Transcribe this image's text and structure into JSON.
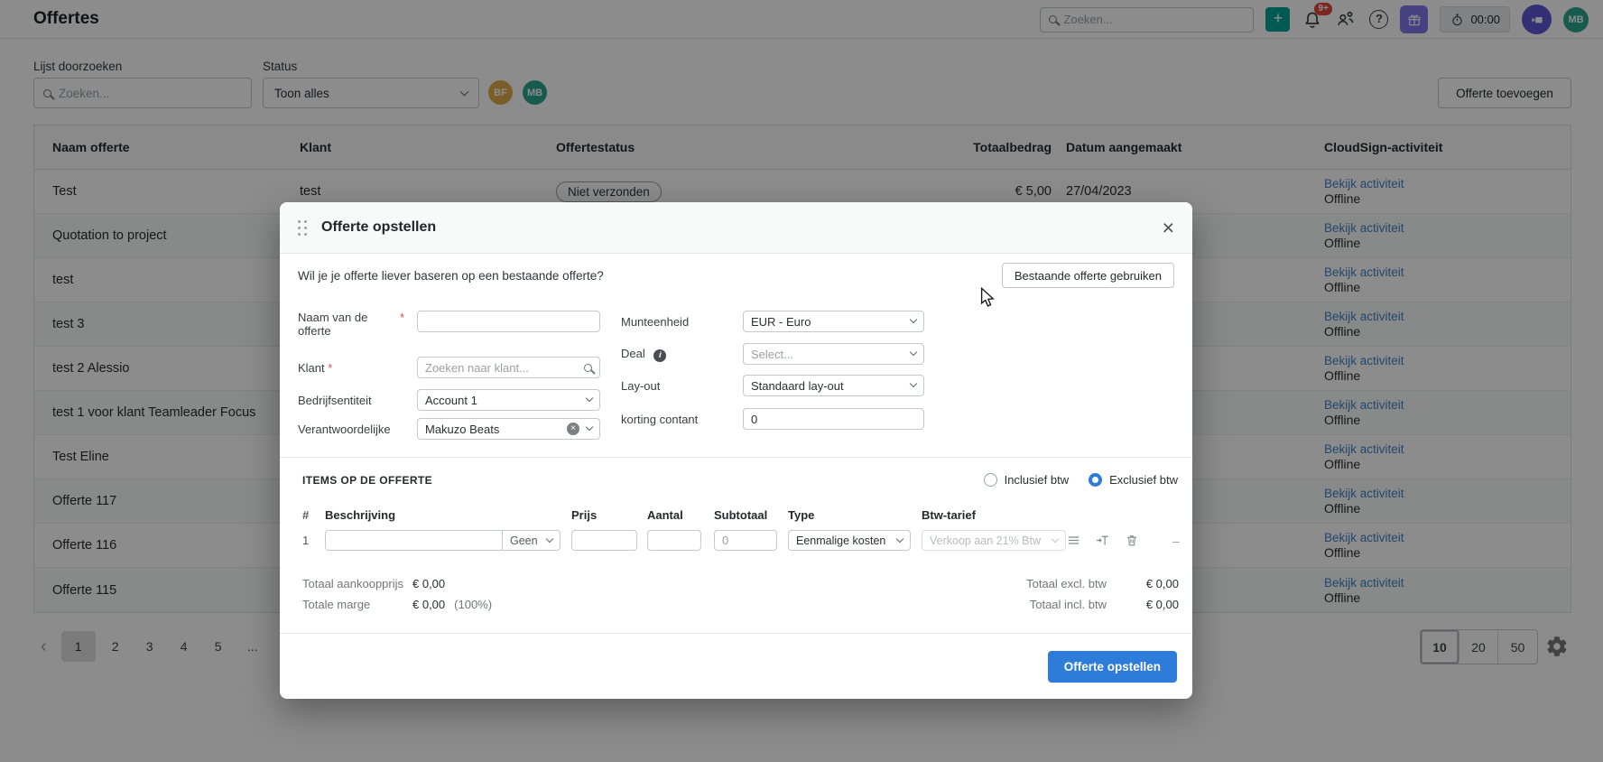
{
  "app": {
    "page_title": "Offertes",
    "topbar": {
      "search_placeholder": "Zoeken...",
      "notification_badge": "9+",
      "timer_value": "00:00",
      "user_initials": "MB"
    },
    "filters": {
      "search_label": "Lijst doorzoeken",
      "search_placeholder": "Zoeken...",
      "status_label": "Status",
      "status_value": "Toon alles",
      "avatar_1": "BF",
      "avatar_2": "MB",
      "add_button": "Offerte toevoegen"
    }
  },
  "table": {
    "columns": [
      "Naam offerte",
      "Klant",
      "Offertestatus",
      "Totaalbedrag",
      "Datum aangemaakt",
      "CloudSign-activiteit"
    ],
    "rows": [
      {
        "name": "Test",
        "klant": "test",
        "status": "Niet verzonden",
        "amount": "€ 5,00",
        "date": "27/04/2023",
        "activity": "Bekijk activiteit",
        "state": "Offline"
      },
      {
        "name": "Quotation to project",
        "klant": "",
        "status": "",
        "amount": "",
        "date": "",
        "activity": "Bekijk activiteit",
        "state": "Offline"
      },
      {
        "name": "test",
        "klant": "",
        "status": "",
        "amount": "",
        "date": "",
        "activity": "Bekijk activiteit",
        "state": "Offline"
      },
      {
        "name": "test 3",
        "klant": "",
        "status": "",
        "amount": "",
        "date": "",
        "activity": "Bekijk activiteit",
        "state": "Offline"
      },
      {
        "name": "test 2 Alessio",
        "klant": "",
        "status": "",
        "amount": "",
        "date": "",
        "activity": "Bekijk activiteit",
        "state": "Offline"
      },
      {
        "name": "test 1 voor klant Teamleader Focus",
        "klant": "",
        "status": "",
        "amount": "",
        "date": "",
        "activity": "Bekijk activiteit",
        "state": "Offline"
      },
      {
        "name": "Test Eline",
        "klant": "",
        "status": "",
        "amount": "",
        "date": "",
        "activity": "Bekijk activiteit",
        "state": "Offline"
      },
      {
        "name": "Offerte 117",
        "klant": "",
        "status": "",
        "amount": "",
        "date": "",
        "activity": "Bekijk activiteit",
        "state": "Offline"
      },
      {
        "name": "Offerte 116",
        "klant": "",
        "status": "",
        "amount": "",
        "date": "",
        "activity": "Bekijk activiteit",
        "state": "Offline"
      },
      {
        "name": "Offerte 115",
        "klant": "",
        "status": "",
        "amount": "",
        "date": "",
        "activity": "Bekijk activiteit",
        "state": "Offline"
      }
    ]
  },
  "pagination": {
    "prev": "‹",
    "pages": [
      "1",
      "2",
      "3",
      "4",
      "5",
      "..."
    ],
    "active_page": "1",
    "sizes": [
      "10",
      "20",
      "50"
    ],
    "active_size": "10"
  },
  "modal": {
    "title": "Offerte opstellen",
    "question": "Wil je je offerte liever baseren op een bestaande offerte?",
    "existing_button": "Bestaande offerte gebruiken",
    "fields": {
      "naam": {
        "label": "Naam van de offerte",
        "required": "*",
        "value": ""
      },
      "klant": {
        "label": "Klant",
        "required": "*",
        "placeholder": "Zoeken naar klant..."
      },
      "bedrijfsentiteit": {
        "label": "Bedrijfsentiteit",
        "value": "Account 1"
      },
      "verantwoordelijke": {
        "label": "Verantwoordelijke",
        "value": "Makuzo Beats"
      },
      "munteenheid": {
        "label": "Munteenheid",
        "value": "EUR - Euro"
      },
      "deal": {
        "label": "Deal",
        "placeholder": "Select..."
      },
      "layout": {
        "label": "Lay-out",
        "value": "Standaard lay-out"
      },
      "korting": {
        "label": "korting contant",
        "value": "0"
      }
    },
    "items": {
      "heading": "ITEMS OP DE OFFERTE",
      "radio_inclusief": "Inclusief btw",
      "radio_exclusief": "Exclusief btw",
      "selected_radio": "Exclusief btw",
      "columns": [
        "#",
        "Beschrijving",
        "Prijs",
        "Aantal",
        "Subtotaal",
        "Type",
        "Btw-tarief"
      ],
      "row": {
        "num": "1",
        "beschrijving": "",
        "geen": "Geen",
        "prijs": "",
        "aantal": "",
        "subtotaal": "0",
        "type": "Eenmalige kosten",
        "btw": "Verkoop aan 21% Btw"
      }
    },
    "totals": {
      "aankoop_label": "Totaal aankoopprijs",
      "aankoop_value": "€ 0,00",
      "marge_label": "Totale marge",
      "marge_value": "€ 0,00",
      "marge_pct": "(100%)",
      "excl_label": "Totaal excl. btw",
      "excl_value": "€ 0,00",
      "incl_label": "Totaal incl. btw",
      "incl_value": "€ 0,00"
    },
    "submit_button": "Offerte opstellen"
  },
  "icons": {
    "plus": "+",
    "help": "?",
    "close": "×",
    "dash": "–",
    "clear": "×",
    "info": "i"
  },
  "colors": {
    "accent_teal": "#00a396",
    "primary_blue": "#2e7cd9",
    "link_blue": "#3f82c6",
    "badge_red": "#e2453b",
    "gift_purple": "#8078ec",
    "brand_purple": "#6058d8",
    "avatar_gold": "#dcae47",
    "avatar_teal": "#2ba58e"
  }
}
